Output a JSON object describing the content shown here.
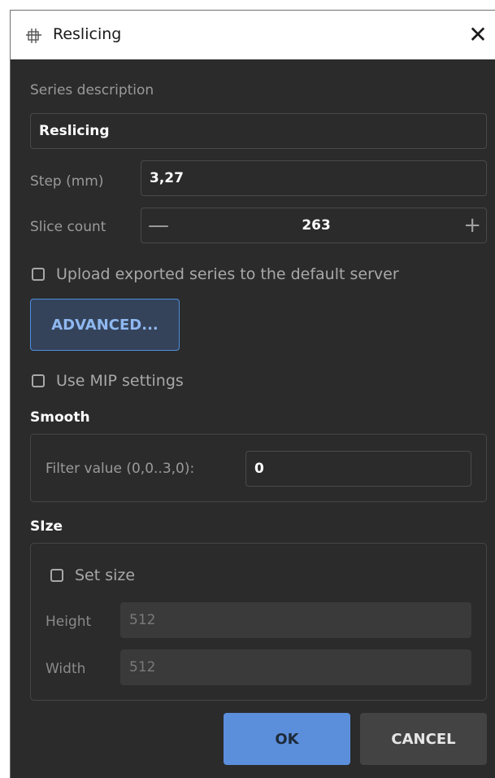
{
  "dialog": {
    "title": "Reslicing",
    "title_icon": "reslice-icon",
    "close_glyph": "✕"
  },
  "form": {
    "series_description_label": "Series description",
    "series_description_value": "Reslicing",
    "step_label": "Step (mm)",
    "step_value": "3,27",
    "slice_count_label": "Slice count",
    "slice_count_value": "263",
    "decrement_glyph": "—",
    "increment_glyph": "+",
    "upload_label": "Upload exported series to the default server",
    "upload_checked": false,
    "advanced_label": "ADVANCED...",
    "mip_label": "Use MIP settings",
    "mip_checked": false
  },
  "smooth": {
    "title": "Smooth",
    "filter_label": "Filter value (0,0..3,0):",
    "filter_value": "0"
  },
  "size": {
    "title": "SIze",
    "set_size_label": "Set size",
    "set_size_checked": false,
    "height_label": "Height",
    "height_value": "512",
    "width_label": "Width",
    "width_value": "512"
  },
  "buttons": {
    "ok": "OK",
    "cancel": "CANCEL"
  },
  "colors": {
    "background": "#2b2b2b",
    "accent": "#5b8fdc",
    "advanced_border": "#4d8fe0"
  }
}
